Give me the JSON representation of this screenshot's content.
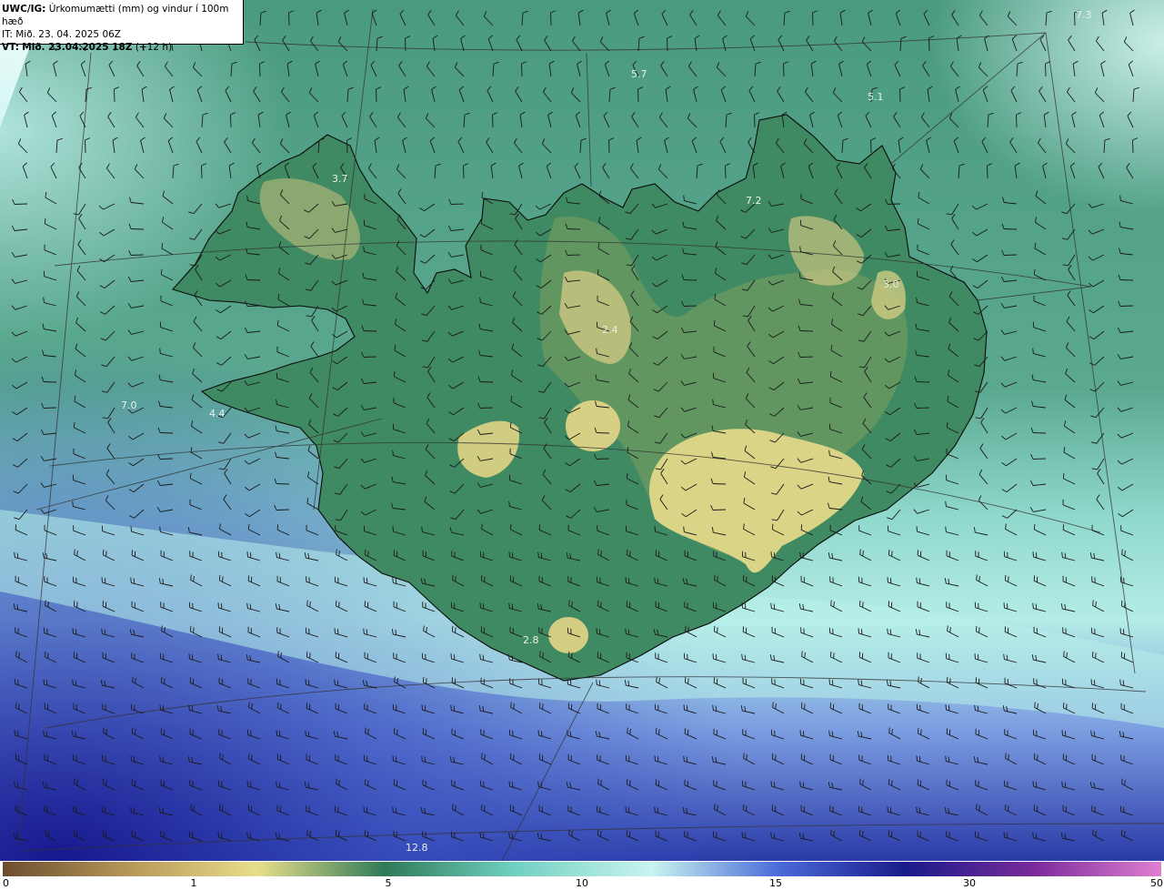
{
  "header": {
    "title_prefix": "UWC/IG:",
    "title_text": "Úrkomumætti (mm) og vindur í 100m hæð",
    "it_line": "IT: Mið. 23. 04. 2025 06Z",
    "vt_prefix": "VT:",
    "vt_bold": "Mið. 23.04.2025 18Z",
    "vt_suffix": "(+12 h)"
  },
  "map_labels": [
    {
      "text": "7.3"
    },
    {
      "text": "5.7"
    },
    {
      "text": "5.1"
    },
    {
      "text": "3.7"
    },
    {
      "text": "7.2"
    },
    {
      "text": "3.0"
    },
    {
      "text": "2.4"
    },
    {
      "text": "7.0"
    },
    {
      "text": "4.4"
    },
    {
      "text": "2.8"
    },
    {
      "text": "12.8"
    }
  ],
  "colorbar": {
    "ticks": [
      "0",
      "1",
      "5",
      "10",
      "15",
      "30",
      "50"
    ],
    "colors": [
      "#6b4d2e",
      "#b89858",
      "#e8de8a",
      "#2f7a58",
      "#6fd0c0",
      "#c8f4f0",
      "#4a6ad8",
      "#1a1a8a",
      "#7a2a9a",
      "#e080d0"
    ]
  }
}
